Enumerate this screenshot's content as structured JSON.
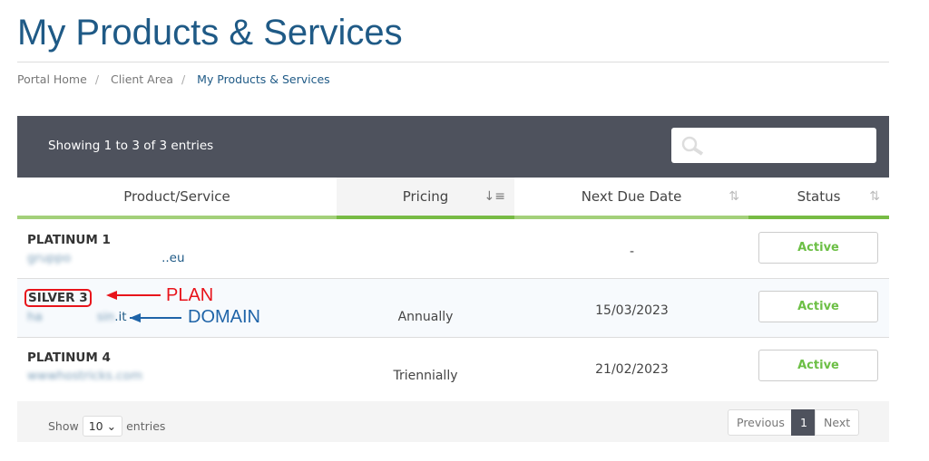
{
  "page_title": "My Products & Services",
  "breadcrumb": [
    "Portal Home",
    "Client Area",
    "My Products & Services"
  ],
  "table": {
    "info": "Showing 1 to 3 of 3 entries",
    "search_placeholder": "",
    "columns": [
      "Product/Service",
      "Pricing",
      "Next Due Date",
      "Status"
    ],
    "rows": [
      {
        "plan": "PLATINUM 1",
        "domain_visible": "..eu",
        "pricing": "",
        "due": "-",
        "status": "Active"
      },
      {
        "plan": "SILVER 3",
        "domain_visible": ".it",
        "pricing": "Annually",
        "due": "15/03/2023",
        "status": "Active"
      },
      {
        "plan": "PLATINUM 4",
        "domain_visible": "",
        "pricing": "Triennially",
        "due": "21/02/2023",
        "status": "Active"
      }
    ],
    "footer": {
      "show": "Show",
      "page_size": "10",
      "entries": "entries",
      "previous": "Previous",
      "page": "1",
      "next": "Next"
    }
  },
  "annotations": {
    "plan": "PLAN",
    "domain": "DOMAIN",
    "plan_color": "#e8141b",
    "domain_color": "#1f64a8"
  },
  "colors": {
    "accent": "#1f5a86",
    "active": "#6cbf45",
    "header_bg": "#4e525d"
  }
}
